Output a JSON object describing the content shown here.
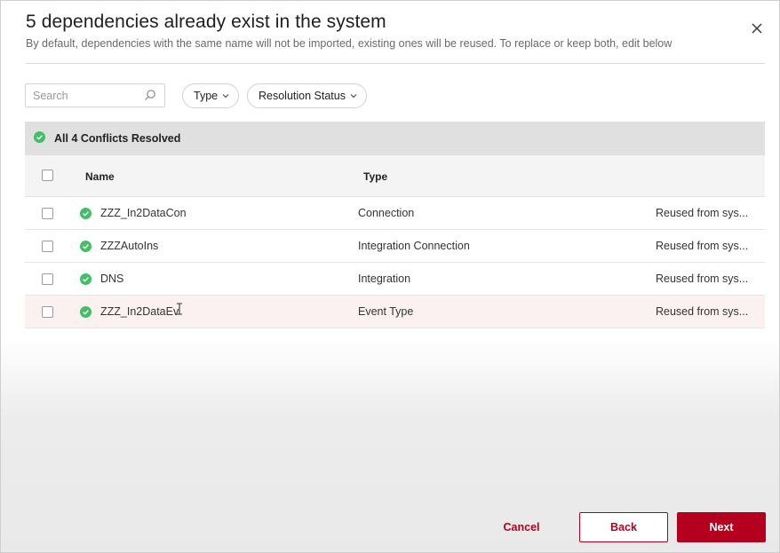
{
  "dialog": {
    "title": "5 dependencies already exist in the system",
    "subtitle": "By default, dependencies with the same name will not be imported, existing ones will be reused. To replace or keep both, edit below",
    "close_icon": "close-icon"
  },
  "toolbar": {
    "search_placeholder": "Search",
    "type_filter_label": "Type",
    "resolution_filter_label": "Resolution Status"
  },
  "banner": {
    "text": "All 4 Conflicts Resolved",
    "icon": "check-circle-icon",
    "status_color": "#42be65"
  },
  "table": {
    "columns": {
      "name": "Name",
      "type": "Type"
    },
    "rows": [
      {
        "name": "ZZZ_In2DataCon",
        "type": "Connection",
        "resolution": "Reused from sys..."
      },
      {
        "name": "ZZZAutoIns",
        "type": "Integration Connection",
        "resolution": "Reused from sys..."
      },
      {
        "name": "DNS",
        "type": "Integration",
        "resolution": "Reused from sys..."
      },
      {
        "name": "ZZZ_In2DataEv",
        "type": "Event Type",
        "resolution": "Reused from sys..."
      }
    ]
  },
  "footer": {
    "cancel_label": "Cancel",
    "back_label": "Back",
    "next_label": "Next",
    "accent_color": "#b4001e"
  }
}
